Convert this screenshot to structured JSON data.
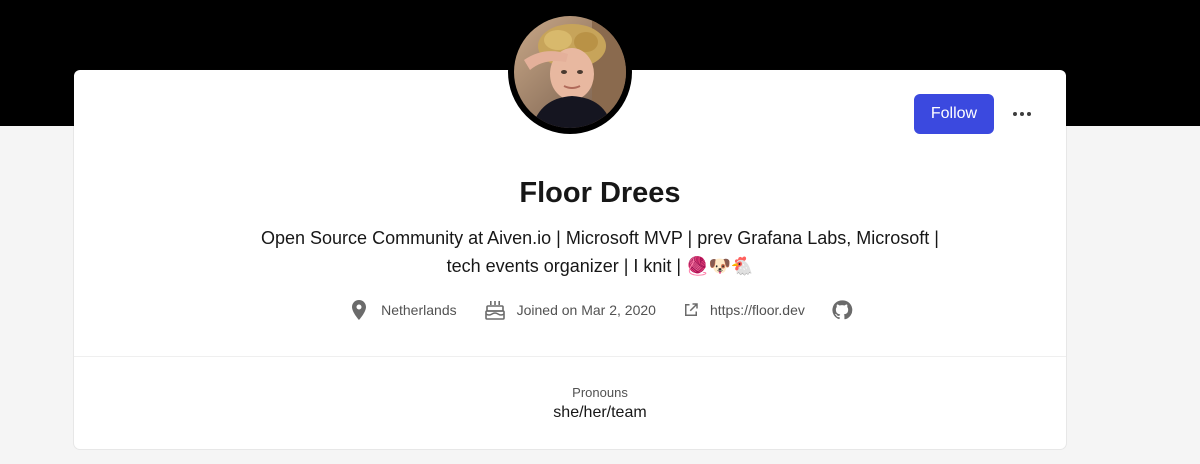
{
  "profile": {
    "name": "Floor Drees",
    "bio_line1": "Open Source Community at Aiven.io | Microsoft MVP | prev Grafana Labs, Microsoft |",
    "bio_line2": "tech events organizer | I knit | 🧶🐶🐔",
    "follow_label": "Follow",
    "location": "Netherlands",
    "joined": "Joined on Mar 2, 2020",
    "website": "https://floor.dev",
    "pronouns_label": "Pronouns",
    "pronouns_value": "she/her/team"
  },
  "icons": {
    "location": "map-pin-icon",
    "joined": "cake-icon",
    "website": "external-link-icon",
    "github": "github-icon",
    "more": "more-horizontal-icon"
  },
  "colors": {
    "banner": "#000000",
    "accent": "#3b49df",
    "page_bg": "#f5f5f5",
    "card_bg": "#ffffff"
  }
}
